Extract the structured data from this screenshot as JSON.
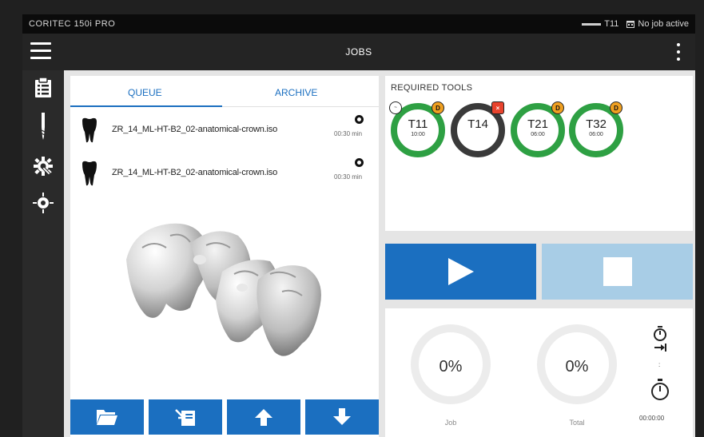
{
  "status_bar": {
    "device_name": "CORITEC 150i PRO",
    "tool_in_spindle": "T11",
    "job_status": "No job active"
  },
  "app_bar": {
    "title": "JOBS",
    "menu_icon": "hamburger-icon",
    "more_icon": "more-vert-icon"
  },
  "sidebar": {
    "items": [
      {
        "name": "jobs",
        "icon": "clipboard-icon",
        "active": true
      },
      {
        "name": "tools",
        "icon": "milling-tool-icon",
        "active": false
      },
      {
        "name": "settings",
        "icon": "gear-wrench-icon",
        "active": false
      },
      {
        "name": "calibration",
        "icon": "crosshair-icon",
        "active": false
      }
    ]
  },
  "queue_panel": {
    "tabs": [
      {
        "label": "QUEUE",
        "active": true
      },
      {
        "label": "ARCHIVE",
        "active": false
      }
    ],
    "jobs": [
      {
        "name": "ZR_14_ML-HT-B2_02-anatomical-crown.iso",
        "time": "00:30 min"
      },
      {
        "name": "ZR_14_ML-HT-B2_02-anatomical-crown.iso",
        "time": "00:30 min"
      }
    ],
    "toolbar": [
      {
        "name": "open-folder",
        "icon": "folder-icon"
      },
      {
        "name": "import",
        "icon": "import-icon"
      },
      {
        "name": "move-up",
        "icon": "arrow-up-icon"
      },
      {
        "name": "move-down",
        "icon": "arrow-down-icon"
      }
    ]
  },
  "required_tools": {
    "header": "REQUIRED TOOLS",
    "tools": [
      {
        "label": "T11",
        "value": "10:00",
        "ring": "#2ea043",
        "badge": "D",
        "badge_color": "#f0a020",
        "left_badge": "~"
      },
      {
        "label": "T14",
        "value": "",
        "ring": "#3a3a3a",
        "badge": "×",
        "badge_color": "#e8432d",
        "left_badge": ""
      },
      {
        "label": "T21",
        "value": "06:00",
        "ring": "#2ea043",
        "badge": "D",
        "badge_color": "#f0a020",
        "left_badge": ""
      },
      {
        "label": "T32",
        "value": "06:00",
        "ring": "#2ea043",
        "badge": "D",
        "badge_color": "#f0a020",
        "left_badge": ""
      }
    ]
  },
  "controls": {
    "play_icon": "play-icon",
    "stop_icon": "stop-icon",
    "accent": "#1b6fc0",
    "disabled": "#a8cde6"
  },
  "progress": {
    "job": {
      "value": "0%",
      "label": "Job"
    },
    "total": {
      "value": "0%",
      "label": "Total"
    },
    "remaining_time": ":",
    "elapsed_time": "00:00:00"
  }
}
